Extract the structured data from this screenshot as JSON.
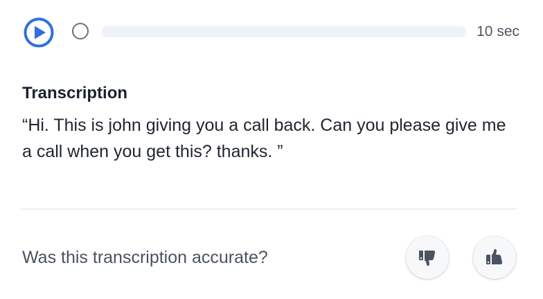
{
  "player": {
    "duration": "10 sec",
    "progress": 0
  },
  "transcription": {
    "title": "Transcription",
    "text": "“Hi. This is john giving you a call back. Can you please give me a call when you get this? thanks. ”"
  },
  "feedback": {
    "question": "Was this transcription accurate?"
  },
  "colors": {
    "accent": "#2f6fe0",
    "track": "#edf2fb",
    "icon": "#4b5260"
  }
}
